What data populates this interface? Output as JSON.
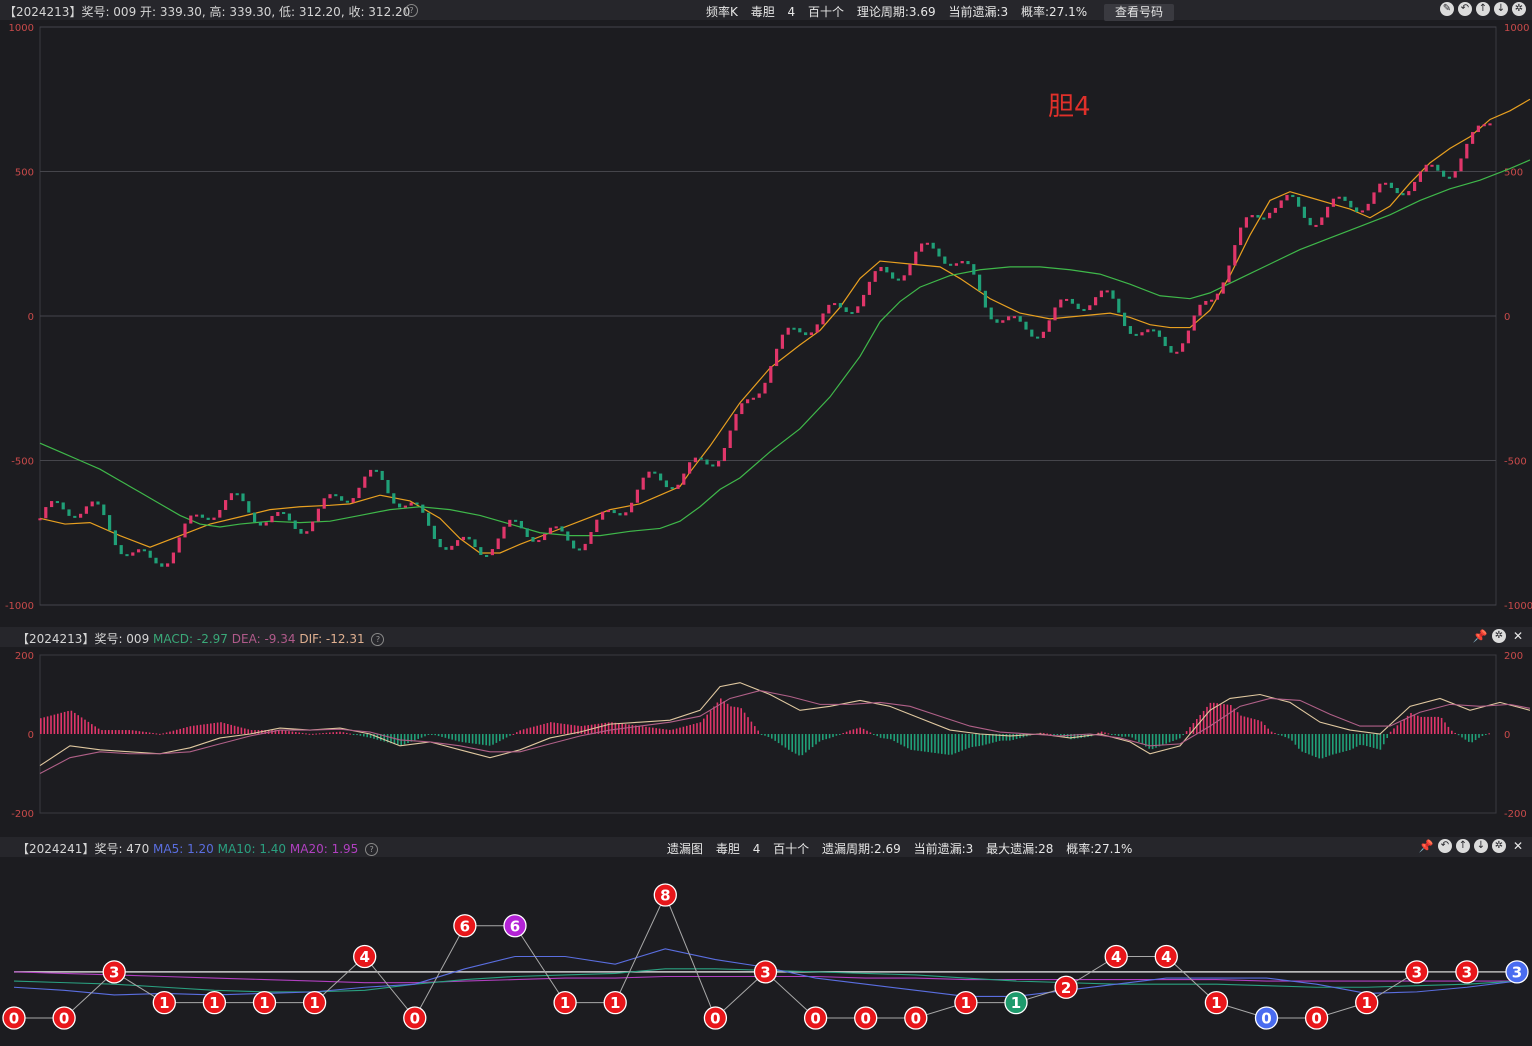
{
  "top_bar": {
    "info": "【2024213】奖号: 009  开: 339.30, 高: 339.30, 低: 312.20, 收: 312.20",
    "center_items": [
      "频率K",
      "毒胆",
      "4",
      "百十个",
      "理论周期:3.69",
      "当前遗漏:3",
      "概率:27.1%"
    ],
    "query_button": "查看号码",
    "icons": [
      "compass-icon",
      "back-icon",
      "up-icon",
      "down-icon",
      "settings-icon"
    ]
  },
  "macd_bar": {
    "prefix": "【2024213】奖号: 009",
    "macd": "MACD: -2.97",
    "dea": "DEA: -9.34",
    "dif": "DIF: -12.31",
    "colors": {
      "macd": "#3aa878",
      "dea": "#b05a8a",
      "dif": "#e0b090"
    },
    "icons": [
      "pin-icon",
      "settings-icon",
      "close-icon"
    ]
  },
  "miss_bar": {
    "prefix": "【2024241】奖号: 470",
    "ma5": "MA5: 1.20",
    "ma10": "MA10: 1.40",
    "ma20": "MA20: 1.95",
    "colors": {
      "ma5": "#5a6ee0",
      "ma10": "#2aa080",
      "ma20": "#b040c0"
    },
    "center_items": [
      "遗漏图",
      "毒胆",
      "4",
      "百十个",
      "遗漏周期:2.69",
      "当前遗漏:3",
      "最大遗漏:28",
      "概率:27.1%"
    ],
    "icons": [
      "pin-icon",
      "back-icon",
      "up-icon",
      "down-icon",
      "settings-icon",
      "close-icon"
    ]
  },
  "chart_data": [
    {
      "type": "candlestick",
      "annotation": "胆4",
      "ylim": [
        -1000,
        1000
      ],
      "yticks": [
        1000,
        500,
        0,
        -500,
        -1000
      ],
      "ma_series": [
        {
          "color": "#e8a020",
          "points": [
            [
              0,
              -700
            ],
            [
              25,
              -720
            ],
            [
              50,
              -715
            ],
            [
              80,
              -760
            ],
            [
              110,
              -800
            ],
            [
              140,
              -760
            ],
            [
              170,
              -720
            ],
            [
              200,
              -695
            ],
            [
              230,
              -670
            ],
            [
              260,
              -660
            ],
            [
              290,
              -655
            ],
            [
              310,
              -650
            ],
            [
              340,
              -620
            ],
            [
              370,
              -640
            ],
            [
              400,
              -700
            ],
            [
              420,
              -770
            ],
            [
              440,
              -820
            ],
            [
              460,
              -820
            ],
            [
              480,
              -790
            ],
            [
              510,
              -750
            ],
            [
              540,
              -710
            ],
            [
              570,
              -670
            ],
            [
              600,
              -650
            ],
            [
              620,
              -620
            ],
            [
              640,
              -590
            ],
            [
              650,
              -540
            ],
            [
              670,
              -450
            ],
            [
              700,
              -300
            ],
            [
              730,
              -180
            ],
            [
              760,
              -100
            ],
            [
              780,
              -50
            ],
            [
              800,
              30
            ],
            [
              820,
              130
            ],
            [
              840,
              190
            ],
            [
              870,
              180
            ],
            [
              900,
              170
            ],
            [
              920,
              130
            ],
            [
              950,
              60
            ],
            [
              980,
              10
            ],
            [
              1010,
              -10
            ],
            [
              1040,
              0
            ],
            [
              1070,
              10
            ],
            [
              1090,
              -5
            ],
            [
              1110,
              -30
            ],
            [
              1130,
              -40
            ],
            [
              1150,
              -40
            ],
            [
              1170,
              20
            ],
            [
              1190,
              140
            ],
            [
              1210,
              280
            ],
            [
              1230,
              400
            ],
            [
              1250,
              430
            ],
            [
              1270,
              410
            ],
            [
              1290,
              390
            ],
            [
              1310,
              370
            ],
            [
              1330,
              340
            ],
            [
              1350,
              380
            ],
            [
              1370,
              460
            ],
            [
              1390,
              530
            ],
            [
              1410,
              580
            ],
            [
              1430,
              620
            ],
            [
              1450,
              680
            ],
            [
              1470,
              710
            ],
            [
              1490,
              750
            ]
          ]
        },
        {
          "color": "#3fb84a",
          "points": [
            [
              0,
              -440
            ],
            [
              20,
              -470
            ],
            [
              40,
              -500
            ],
            [
              60,
              -530
            ],
            [
              80,
              -570
            ],
            [
              100,
              -610
            ],
            [
              120,
              -650
            ],
            [
              140,
              -690
            ],
            [
              160,
              -720
            ],
            [
              180,
              -730
            ],
            [
              200,
              -720
            ],
            [
              230,
              -710
            ],
            [
              260,
              -715
            ],
            [
              290,
              -710
            ],
            [
              320,
              -690
            ],
            [
              350,
              -670
            ],
            [
              380,
              -660
            ],
            [
              410,
              -670
            ],
            [
              440,
              -690
            ],
            [
              470,
              -720
            ],
            [
              500,
              -750
            ],
            [
              530,
              -760
            ],
            [
              560,
              -760
            ],
            [
              590,
              -745
            ],
            [
              620,
              -735
            ],
            [
              640,
              -710
            ],
            [
              660,
              -660
            ],
            [
              680,
              -600
            ],
            [
              700,
              -560
            ],
            [
              730,
              -470
            ],
            [
              760,
              -390
            ],
            [
              790,
              -280
            ],
            [
              820,
              -140
            ],
            [
              840,
              -20
            ],
            [
              860,
              50
            ],
            [
              880,
              100
            ],
            [
              910,
              140
            ],
            [
              940,
              160
            ],
            [
              970,
              170
            ],
            [
              1000,
              170
            ],
            [
              1030,
              160
            ],
            [
              1060,
              145
            ],
            [
              1090,
              110
            ],
            [
              1120,
              70
            ],
            [
              1150,
              60
            ],
            [
              1170,
              80
            ],
            [
              1200,
              130
            ],
            [
              1230,
              180
            ],
            [
              1260,
              230
            ],
            [
              1290,
              270
            ],
            [
              1320,
              310
            ],
            [
              1350,
              350
            ],
            [
              1380,
              400
            ],
            [
              1410,
              440
            ],
            [
              1440,
              470
            ],
            [
              1470,
              510
            ],
            [
              1490,
              540
            ]
          ]
        }
      ]
    },
    {
      "type": "bar+line",
      "indicator": "MACD",
      "ylim": [
        -200,
        200
      ],
      "yticks": [
        200,
        0,
        -200
      ],
      "lines": [
        {
          "color": "#e0c8a0",
          "points": [
            [
              0,
              -80
            ],
            [
              30,
              -30
            ],
            [
              60,
              -40
            ],
            [
              90,
              -45
            ],
            [
              120,
              -50
            ],
            [
              150,
              -35
            ],
            [
              180,
              -10
            ],
            [
              210,
              0
            ],
            [
              240,
              15
            ],
            [
              270,
              10
            ],
            [
              300,
              15
            ],
            [
              330,
              0
            ],
            [
              360,
              -30
            ],
            [
              390,
              -20
            ],
            [
              420,
              -40
            ],
            [
              450,
              -60
            ],
            [
              480,
              -40
            ],
            [
              510,
              -10
            ],
            [
              540,
              5
            ],
            [
              570,
              25
            ],
            [
              600,
              30
            ],
            [
              630,
              35
            ],
            [
              660,
              60
            ],
            [
              680,
              120
            ],
            [
              700,
              130
            ],
            [
              730,
              100
            ],
            [
              760,
              60
            ],
            [
              790,
              70
            ],
            [
              820,
              85
            ],
            [
              850,
              70
            ],
            [
              880,
              40
            ],
            [
              910,
              10
            ],
            [
              940,
              0
            ],
            [
              970,
              -5
            ],
            [
              1000,
              0
            ],
            [
              1030,
              -10
            ],
            [
              1060,
              0
            ],
            [
              1090,
              -20
            ],
            [
              1110,
              -50
            ],
            [
              1140,
              -30
            ],
            [
              1170,
              60
            ],
            [
              1190,
              90
            ],
            [
              1220,
              100
            ],
            [
              1250,
              80
            ],
            [
              1280,
              30
            ],
            [
              1310,
              10
            ],
            [
              1340,
              0
            ],
            [
              1370,
              70
            ],
            [
              1400,
              90
            ],
            [
              1430,
              60
            ],
            [
              1460,
              80
            ],
            [
              1490,
              60
            ]
          ]
        },
        {
          "color": "#b06088",
          "points": [
            [
              0,
              -100
            ],
            [
              30,
              -60
            ],
            [
              60,
              -45
            ],
            [
              90,
              -50
            ],
            [
              120,
              -50
            ],
            [
              150,
              -45
            ],
            [
              180,
              -25
            ],
            [
              210,
              -5
            ],
            [
              240,
              10
            ],
            [
              270,
              10
            ],
            [
              300,
              12
            ],
            [
              330,
              5
            ],
            [
              360,
              -15
            ],
            [
              390,
              -20
            ],
            [
              420,
              -30
            ],
            [
              450,
              -45
            ],
            [
              480,
              -45
            ],
            [
              510,
              -25
            ],
            [
              540,
              -5
            ],
            [
              570,
              10
            ],
            [
              600,
              20
            ],
            [
              630,
              30
            ],
            [
              660,
              45
            ],
            [
              690,
              90
            ],
            [
              720,
              110
            ],
            [
              750,
              95
            ],
            [
              780,
              75
            ],
            [
              810,
              75
            ],
            [
              840,
              80
            ],
            [
              870,
              70
            ],
            [
              900,
              45
            ],
            [
              930,
              20
            ],
            [
              960,
              5
            ],
            [
              990,
              0
            ],
            [
              1020,
              -5
            ],
            [
              1050,
              0
            ],
            [
              1080,
              -10
            ],
            [
              1110,
              -30
            ],
            [
              1140,
              -25
            ],
            [
              1170,
              20
            ],
            [
              1200,
              70
            ],
            [
              1230,
              90
            ],
            [
              1260,
              85
            ],
            [
              1290,
              50
            ],
            [
              1320,
              20
            ],
            [
              1350,
              20
            ],
            [
              1380,
              55
            ],
            [
              1410,
              75
            ],
            [
              1440,
              70
            ],
            [
              1470,
              75
            ],
            [
              1490,
              65
            ]
          ]
        }
      ]
    },
    {
      "type": "line+markers",
      "indicator": "遗漏图",
      "markers": [
        0,
        0,
        3,
        1,
        1,
        1,
        1,
        4,
        0,
        6,
        6,
        1,
        1,
        8,
        0,
        3,
        0,
        0,
        0,
        1,
        1,
        2,
        4,
        4,
        1,
        0,
        0,
        1,
        3,
        3,
        3
      ],
      "marker_colors": [
        "red",
        "red",
        "red",
        "red",
        "red",
        "red",
        "red",
        "red",
        "red",
        "red",
        "purple",
        "red",
        "red",
        "red",
        "red",
        "red",
        "red",
        "red",
        "red",
        "red",
        "green",
        "red",
        "red",
        "red",
        "red",
        "blue",
        "red",
        "red",
        "red",
        "red",
        "blue"
      ],
      "ma5_points": [
        2,
        1.8,
        1.5,
        1.6,
        1.5,
        1.6,
        1.7,
        2.0,
        2.2,
        3.2,
        4.0,
        4.0,
        3.5,
        4.5,
        3.8,
        3.3,
        2.6,
        2.2,
        1.8,
        1.4,
        1.4,
        1.8,
        2.2,
        2.6,
        2.6,
        2.6,
        2.2,
        1.6,
        1.7,
        2.0,
        2.4
      ],
      "ma10_points": [
        2.4,
        2.3,
        2.2,
        2.0,
        1.8,
        1.7,
        1.7,
        1.8,
        2.2,
        2.5,
        2.7,
        2.8,
        2.9,
        3.2,
        3.2,
        3.1,
        3.0,
        2.9,
        2.8,
        2.6,
        2.4,
        2.3,
        2.2,
        2.2,
        2.2,
        2.1,
        2.0,
        2.0,
        2.1,
        2.2,
        2.4
      ],
      "ma20_points": [
        3.0,
        2.9,
        2.8,
        2.7,
        2.6,
        2.5,
        2.4,
        2.3,
        2.3,
        2.4,
        2.5,
        2.6,
        2.6,
        2.7,
        2.7,
        2.7,
        2.7,
        2.6,
        2.6,
        2.5,
        2.5,
        2.5,
        2.5,
        2.5,
        2.5,
        2.4,
        2.4,
        2.4,
        2.4,
        2.4,
        2.4
      ],
      "baseline": 3
    }
  ]
}
